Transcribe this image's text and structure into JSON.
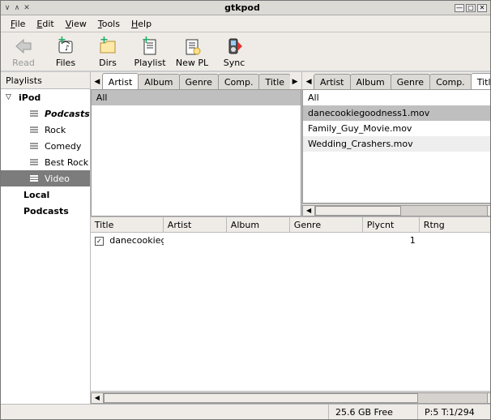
{
  "window": {
    "title": "gtkpod"
  },
  "menu": {
    "items": [
      "File",
      "Edit",
      "View",
      "Tools",
      "Help"
    ]
  },
  "toolbar": [
    {
      "label": "Read",
      "disabled": true
    },
    {
      "label": "Files",
      "disabled": false
    },
    {
      "label": "Dirs",
      "disabled": false
    },
    {
      "label": "Playlist",
      "disabled": false
    },
    {
      "label": "New PL",
      "disabled": false
    },
    {
      "label": "Sync",
      "disabled": false
    }
  ],
  "sidebar": {
    "header": "Playlists",
    "tree": {
      "root": "iPod",
      "children": [
        {
          "label": "Podcasts",
          "bold": true
        },
        {
          "label": "Rock"
        },
        {
          "label": "Comedy"
        },
        {
          "label": "Best Rock"
        },
        {
          "label": "Video",
          "selected": true
        }
      ],
      "extra": [
        "Local",
        "Podcasts"
      ]
    }
  },
  "filter_tabs": [
    "Artist",
    "Album",
    "Genre",
    "Comp.",
    "Title"
  ],
  "left_filter": {
    "active": "Artist",
    "all_label": "All",
    "rows": []
  },
  "right_filter": {
    "active": "Title",
    "all_label": "All",
    "rows": [
      {
        "label": "danecookiegoodness1.mov",
        "sel": true
      },
      {
        "label": "Family_Guy_Movie.mov"
      },
      {
        "label": "Wedding_Crashers.mov"
      }
    ]
  },
  "tracks": {
    "columns": [
      "Title",
      "Artist",
      "Album",
      "Genre",
      "Plycnt",
      "Rtng"
    ],
    "rows": [
      {
        "checked": true,
        "Title": "danecookieg",
        "Artist": "",
        "Album": "",
        "Genre": "",
        "Plycnt": "1",
        "Rtng": "0"
      }
    ]
  },
  "status": {
    "diskfree": "25.6 GB Free",
    "counts": "P:5 T:1/294"
  }
}
